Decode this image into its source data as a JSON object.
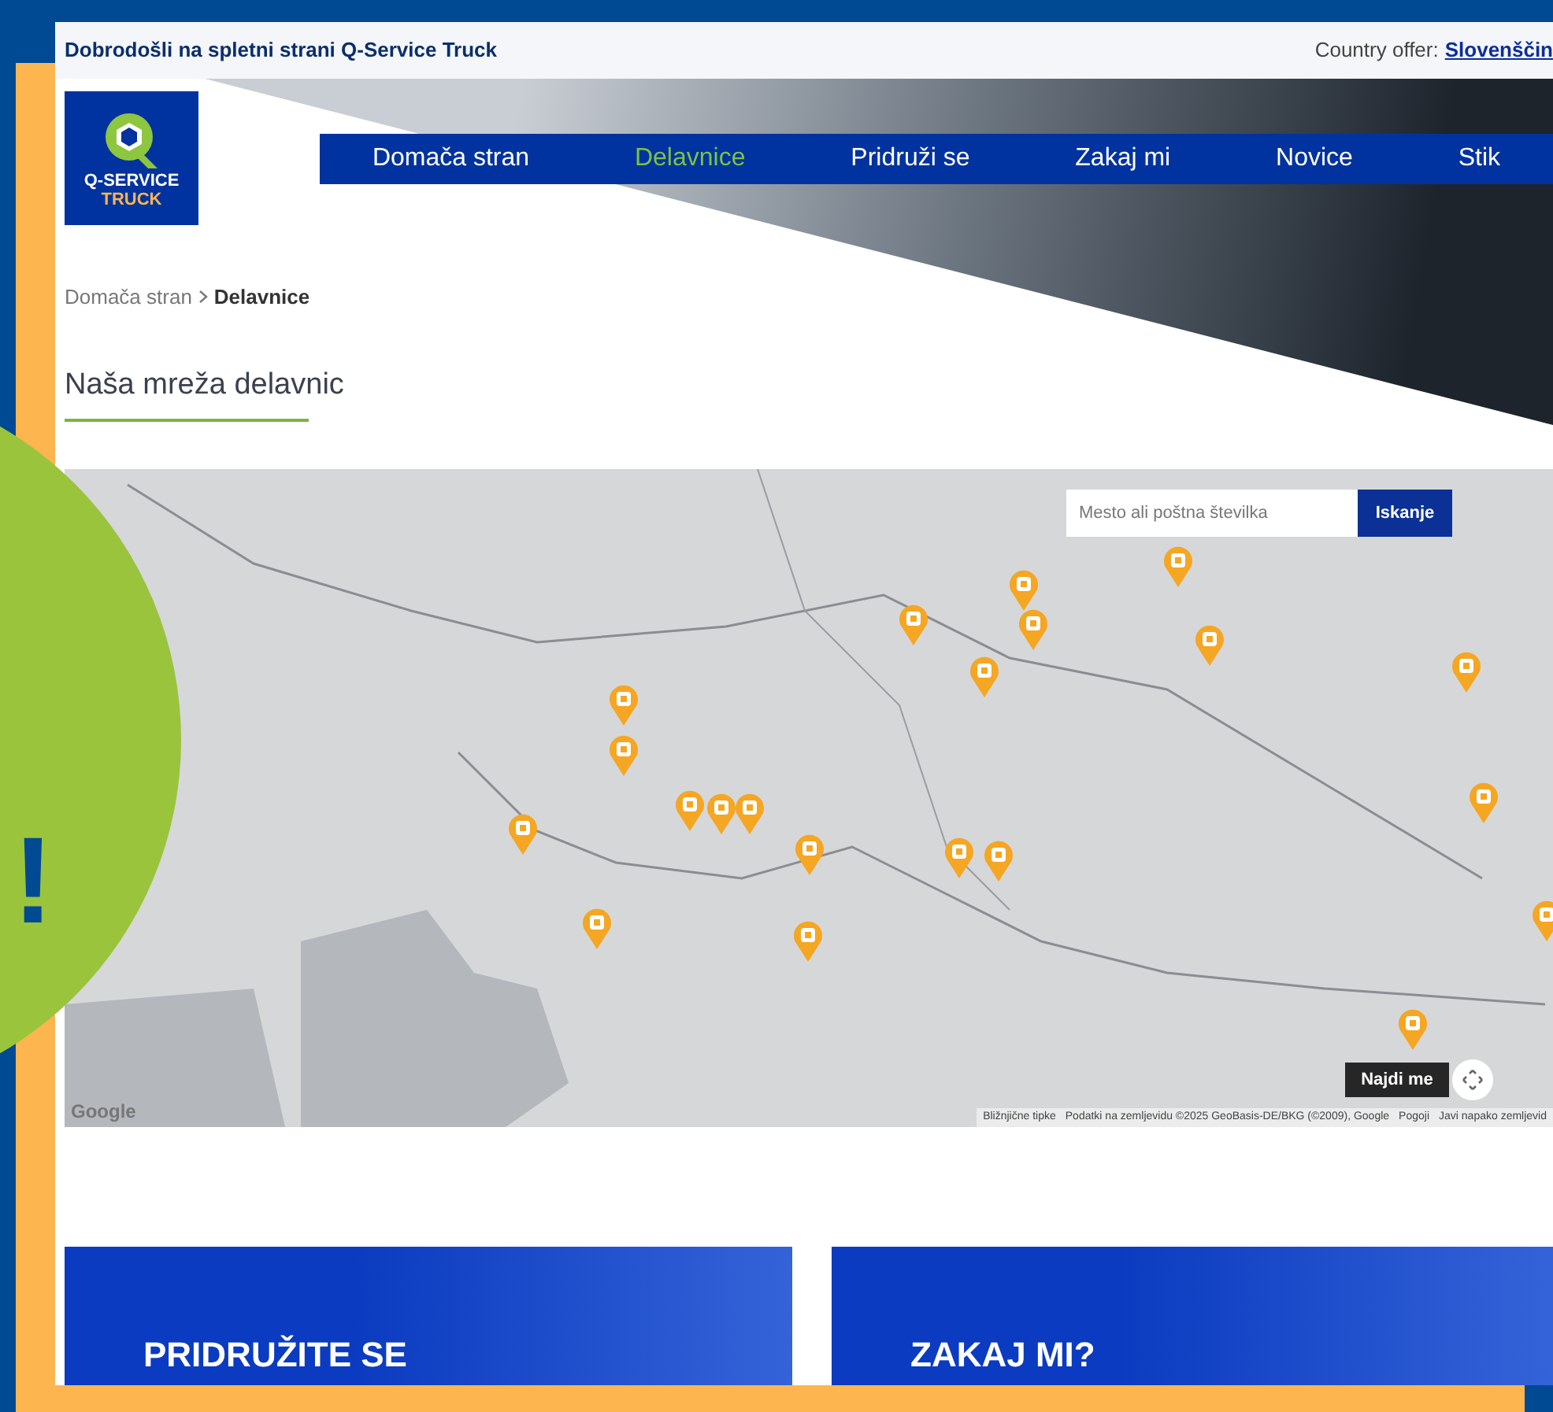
{
  "overlay": {
    "exclamation": "!"
  },
  "top_bar": {
    "welcome": "Dobrodošli na spletni strani Q-Service Truck",
    "country_label": "Country offer:",
    "country_link": "Slovenščin"
  },
  "logo": {
    "line_1": "Q-SERVICE",
    "line_2": "TRUCK"
  },
  "nav": [
    {
      "label": "Domača stran",
      "selected": false
    },
    {
      "label": "Delavnice",
      "selected": true
    },
    {
      "label": "Pridruži se",
      "selected": false
    },
    {
      "label": "Zakaj mi",
      "selected": false
    },
    {
      "label": "Novice",
      "selected": false
    },
    {
      "label": "Stik",
      "selected": false
    }
  ],
  "breadcrumb": [
    {
      "label": "Domača stran",
      "current": false
    },
    {
      "label": "Delavnice",
      "current": true
    }
  ],
  "heading": "Naša mreža delavnic",
  "map": {
    "search_placeholder": "Mesto ali poštna številka",
    "search_button": "Iskanje",
    "locate_button": "Najdi me",
    "logo": "Google",
    "attribution": [
      "Bližnjične tipke",
      "Podatki na zemljevidu ©2025 GeoBasis-DE/BKG (©2009), Google",
      "Pogoji",
      "Javi napako zemljevid"
    ]
  },
  "cards": [
    {
      "title": "PRIDRUŽITE SE"
    },
    {
      "title": "ZAKAJ MI?"
    }
  ]
}
